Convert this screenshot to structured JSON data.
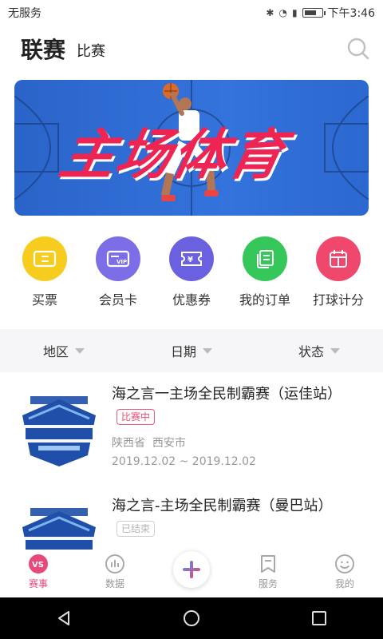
{
  "status_bar": {
    "carrier": "无服务",
    "time": "下午3:46"
  },
  "header": {
    "title": "联赛",
    "subtitle": "比赛"
  },
  "banner": {
    "title": "主场体育"
  },
  "quick_actions": [
    {
      "label": "买票",
      "icon": "ticket-icon",
      "color": "#f6cc1f"
    },
    {
      "label": "会员卡",
      "icon": "vip-card-icon",
      "color": "#7b6ee6"
    },
    {
      "label": "优惠券",
      "icon": "coupon-icon",
      "color": "#6b61e0"
    },
    {
      "label": "我的订单",
      "icon": "order-icon",
      "color": "#35c75a"
    },
    {
      "label": "打球计分",
      "icon": "scoreboard-icon",
      "color": "#f0476c"
    }
  ],
  "filters": [
    {
      "label": "地区"
    },
    {
      "label": "日期"
    },
    {
      "label": "状态"
    }
  ],
  "events": [
    {
      "name": "海之言一主场全民制霸赛（运佳站）",
      "status": "比赛中",
      "province": "陕西省",
      "city": "西安市",
      "dates": "2019.12.02 ~ 2019.12.02"
    },
    {
      "name": "海之言-主场全民制霸赛（曼巴站）",
      "status": "已结束"
    }
  ],
  "tabs": [
    {
      "label": "赛事",
      "active": true
    },
    {
      "label": "数据"
    },
    {
      "label": ""
    },
    {
      "label": "服务"
    },
    {
      "label": "我的"
    }
  ],
  "colors": {
    "accent": "#e8487a",
    "banner_blue": "#2f6fd6"
  }
}
